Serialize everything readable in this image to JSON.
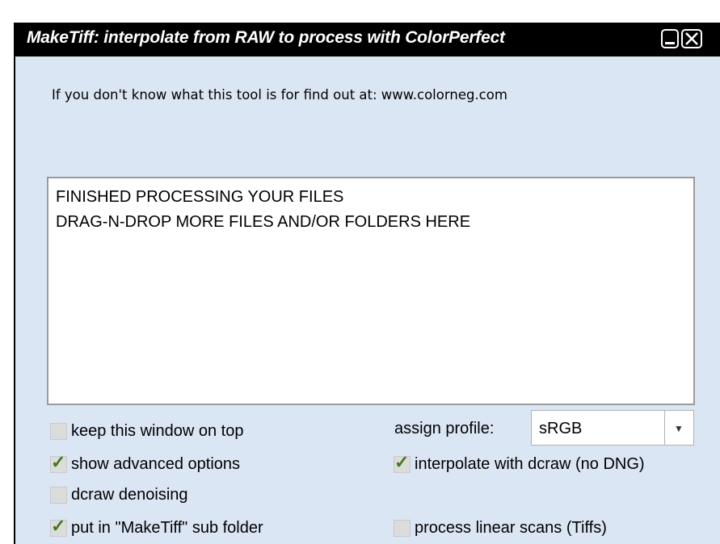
{
  "window": {
    "title": "MakeTiff: interpolate from RAW to process with ColorPerfect"
  },
  "info_text": "If you don't know what this tool is for find out at: www.colorneg.com",
  "dropzone": {
    "lines": [
      "FINISHED PROCESSING YOUR FILES",
      "DRAG-N-DROP MORE FILES AND/OR FOLDERS HERE"
    ]
  },
  "options": {
    "keep_on_top": {
      "label": "keep this window on top",
      "checked": false
    },
    "show_advanced": {
      "label": "show advanced options",
      "checked": true
    },
    "dcraw_denoising": {
      "label": "dcraw denoising",
      "checked": false
    },
    "maketiff_subfolder": {
      "label": "put in \"MakeTiff\" sub folder",
      "checked": true
    },
    "interpolate_dcraw": {
      "label": "interpolate with dcraw (no DNG)",
      "checked": true
    },
    "linear_scans": {
      "label": "process linear scans (Tiffs)",
      "checked": false
    }
  },
  "profile": {
    "label": "assign profile:",
    "selected": "sRGB"
  },
  "icons": {
    "minimize": "minimize-icon",
    "close": "close-icon",
    "dropdown": "chevron-down-icon",
    "checkmark": "checkmark-icon"
  },
  "colors": {
    "window_bg": "#dbe6f4",
    "titlebar_bg": "#000000",
    "check_green": "#3f7a1a"
  }
}
